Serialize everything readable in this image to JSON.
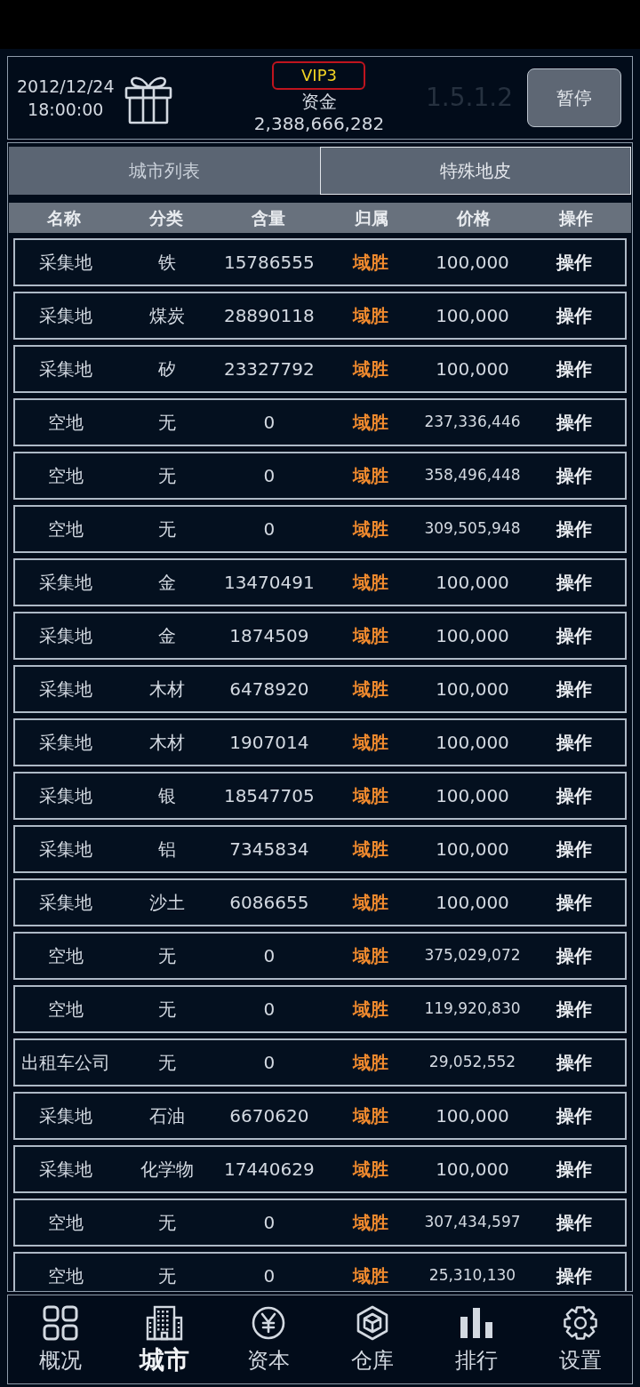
{
  "header": {
    "date": "2012/12/24",
    "time": "18:00:00",
    "vip": "VIP3",
    "funds_label": "资金",
    "funds": "2,388,666,282",
    "version": "1.5.1.2",
    "pause_button": "暂停"
  },
  "tabs": [
    {
      "label": "城市列表",
      "selected": false
    },
    {
      "label": "特殊地皮",
      "selected": true
    }
  ],
  "table": {
    "columns": [
      "名称",
      "分类",
      "含量",
      "归属",
      "价格",
      "操作"
    ],
    "rows": [
      {
        "name": "采集地",
        "category": "铁",
        "amount": "15786555",
        "owner": "域胜",
        "price": "100,000",
        "action": "操作"
      },
      {
        "name": "采集地",
        "category": "煤炭",
        "amount": "28890118",
        "owner": "域胜",
        "price": "100,000",
        "action": "操作"
      },
      {
        "name": "采集地",
        "category": "矽",
        "amount": "23327792",
        "owner": "域胜",
        "price": "100,000",
        "action": "操作"
      },
      {
        "name": "空地",
        "category": "无",
        "amount": "0",
        "owner": "域胜",
        "price": "237,336,446",
        "action": "操作"
      },
      {
        "name": "空地",
        "category": "无",
        "amount": "0",
        "owner": "域胜",
        "price": "358,496,448",
        "action": "操作"
      },
      {
        "name": "空地",
        "category": "无",
        "amount": "0",
        "owner": "域胜",
        "price": "309,505,948",
        "action": "操作"
      },
      {
        "name": "采集地",
        "category": "金",
        "amount": "13470491",
        "owner": "域胜",
        "price": "100,000",
        "action": "操作"
      },
      {
        "name": "采集地",
        "category": "金",
        "amount": "1874509",
        "owner": "域胜",
        "price": "100,000",
        "action": "操作"
      },
      {
        "name": "采集地",
        "category": "木材",
        "amount": "6478920",
        "owner": "域胜",
        "price": "100,000",
        "action": "操作"
      },
      {
        "name": "采集地",
        "category": "木材",
        "amount": "1907014",
        "owner": "域胜",
        "price": "100,000",
        "action": "操作"
      },
      {
        "name": "采集地",
        "category": "银",
        "amount": "18547705",
        "owner": "域胜",
        "price": "100,000",
        "action": "操作"
      },
      {
        "name": "采集地",
        "category": "铝",
        "amount": "7345834",
        "owner": "域胜",
        "price": "100,000",
        "action": "操作"
      },
      {
        "name": "采集地",
        "category": "沙土",
        "amount": "6086655",
        "owner": "域胜",
        "price": "100,000",
        "action": "操作"
      },
      {
        "name": "空地",
        "category": "无",
        "amount": "0",
        "owner": "域胜",
        "price": "375,029,072",
        "action": "操作"
      },
      {
        "name": "空地",
        "category": "无",
        "amount": "0",
        "owner": "域胜",
        "price": "119,920,830",
        "action": "操作"
      },
      {
        "name": "出租车公司",
        "category": "无",
        "amount": "0",
        "owner": "域胜",
        "price": "29,052,552",
        "action": "操作"
      },
      {
        "name": "采集地",
        "category": "石油",
        "amount": "6670620",
        "owner": "域胜",
        "price": "100,000",
        "action": "操作"
      },
      {
        "name": "采集地",
        "category": "化学物",
        "amount": "17440629",
        "owner": "域胜",
        "price": "100,000",
        "action": "操作"
      },
      {
        "name": "空地",
        "category": "无",
        "amount": "0",
        "owner": "域胜",
        "price": "307,434,597",
        "action": "操作"
      },
      {
        "name": "空地",
        "category": "无",
        "amount": "0",
        "owner": "域胜",
        "price": "25,310,130",
        "action": "操作"
      }
    ]
  },
  "nav": [
    {
      "label": "概况",
      "selected": false
    },
    {
      "label": "城市",
      "selected": true
    },
    {
      "label": "资本",
      "selected": false
    },
    {
      "label": "仓库",
      "selected": false
    },
    {
      "label": "排行",
      "selected": false
    },
    {
      "label": "设置",
      "selected": false
    }
  ]
}
